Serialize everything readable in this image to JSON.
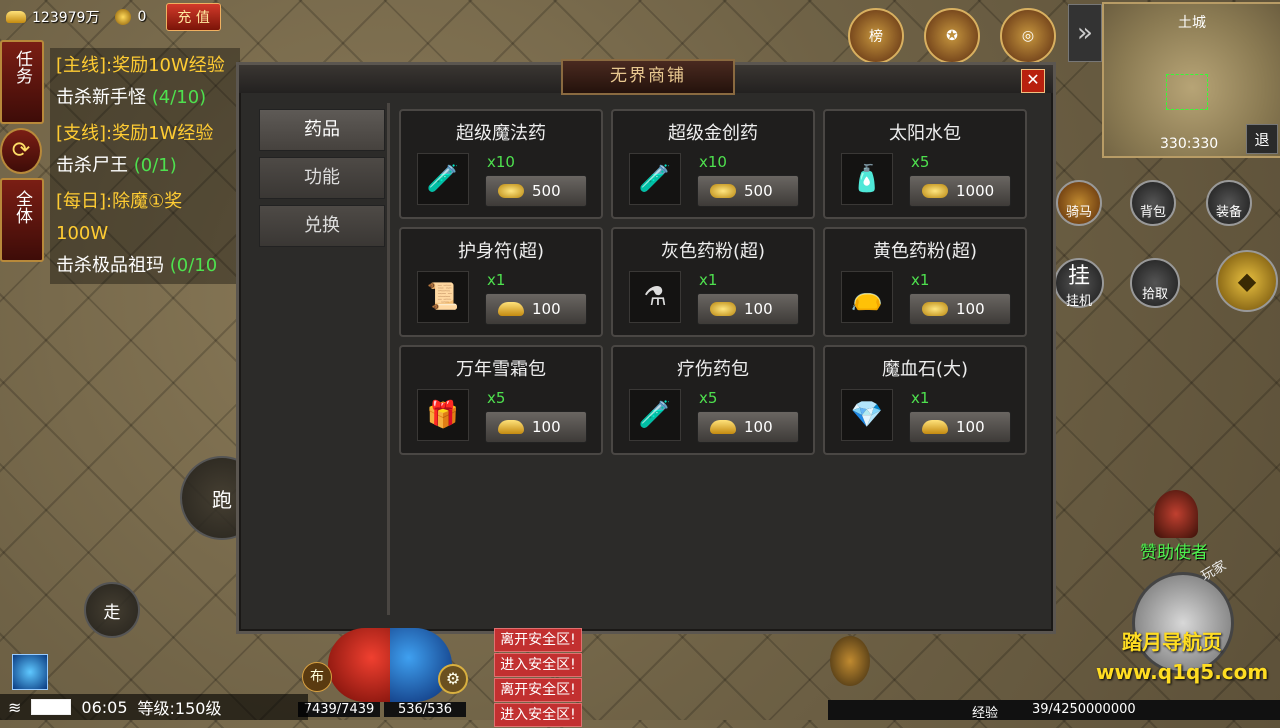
{
  "currency": {
    "gold": "123979万",
    "coins": "0",
    "recharge_label": "充 值"
  },
  "quest_tabs": {
    "task": "任务",
    "all": "全体"
  },
  "quests": [
    {
      "title": "[主线]:奖励10W经验",
      "body": "击杀新手怪",
      "progress": "(4/10)"
    },
    {
      "title": "[支线]:奖励1W经验",
      "body": "击杀尸王",
      "progress": "(0/1)"
    },
    {
      "title": "[每日]:除魔①奖100W",
      "body": "击杀极品祖玛",
      "progress": "(0/10"
    }
  ],
  "minimap": {
    "title": "土城",
    "coords": "330:330",
    "exit_label": "退"
  },
  "side_icons": {
    "mount": "骑马",
    "bag": "背包",
    "equip": "装备",
    "auto": "挂机",
    "auto_big": "挂",
    "pickup": "拾取"
  },
  "shop": {
    "title": "无界商铺",
    "close": "✕",
    "categories": [
      "药品",
      "功能",
      "兑换"
    ],
    "items": [
      {
        "name": "超级魔法药",
        "qty": "x10",
        "price": "500",
        "currency": "gold",
        "icon": "blue-potion-icon",
        "glyph": "🧪"
      },
      {
        "name": "超级金创药",
        "qty": "x10",
        "price": "500",
        "currency": "gold",
        "icon": "red-potion-icon",
        "glyph": "🧪"
      },
      {
        "name": "太阳水包",
        "qty": "x5",
        "price": "1000",
        "currency": "gold",
        "icon": "sun-water-icon",
        "glyph": "🧴"
      },
      {
        "name": "护身符(超)",
        "qty": "x1",
        "price": "100",
        "currency": "ingot",
        "icon": "amulet-icon",
        "glyph": "📜"
      },
      {
        "name": "灰色药粉(超)",
        "qty": "x1",
        "price": "100",
        "currency": "gold",
        "icon": "gray-powder-icon",
        "glyph": "⚗"
      },
      {
        "name": "黄色药粉(超)",
        "qty": "x1",
        "price": "100",
        "currency": "gold",
        "icon": "yellow-powder-icon",
        "glyph": "👝"
      },
      {
        "name": "万年雪霜包",
        "qty": "x5",
        "price": "100",
        "currency": "ingot",
        "icon": "snow-frost-icon",
        "glyph": "🎁"
      },
      {
        "name": "疗伤药包",
        "qty": "x5",
        "price": "100",
        "currency": "ingot",
        "icon": "healing-pack-icon",
        "glyph": "🧪"
      },
      {
        "name": "魔血石(大)",
        "qty": "x1",
        "price": "100",
        "currency": "ingot",
        "icon": "blood-stone-icon",
        "glyph": "💎"
      }
    ]
  },
  "hud": {
    "time": "06:05",
    "level": "等级:150级",
    "hp": "7439/7439",
    "mp": "536/536",
    "exp_label": "经验",
    "exp_value": "39/4250000000",
    "run": "跑",
    "walk": "走",
    "bu": "布"
  },
  "zone_msgs": [
    "离开安全区!",
    "进入安全区!",
    "离开安全区!",
    "进入安全区!"
  ],
  "sponsor": "赞助使者",
  "play_label": "玩家",
  "watermark": {
    "line1": "踏月导航页",
    "line2": "www.q1q5.com"
  }
}
